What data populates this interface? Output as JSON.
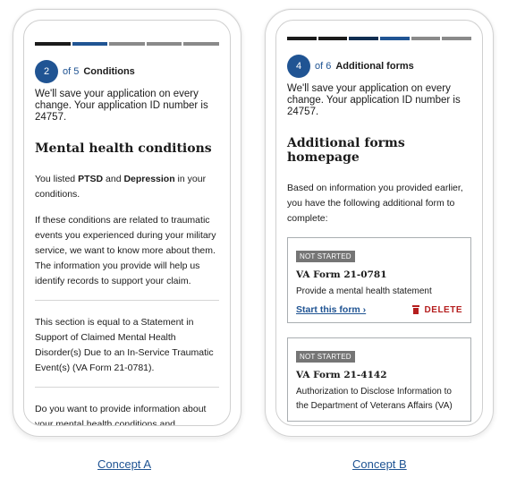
{
  "concept_a": {
    "progress": [
      "done",
      "current",
      "todo",
      "todo",
      "todo"
    ],
    "step_number": "2",
    "step_of": "of 5",
    "step_title": "Conditions",
    "save_text": "We'll save your application on every change. Your application ID number is 24757.",
    "heading": "Mental health conditions",
    "listed_pre": "You listed ",
    "listed_c1": "PTSD",
    "listed_and": " and ",
    "listed_c2": "Depression",
    "listed_post": " in your conditions.",
    "para_related": "If these conditions are related to traumatic events you experienced during your military service, we want to know more about them. The information you provide will help us identify records to support your claim.",
    "para_section": "This section is equal to a Statement in Support of Claimed Mental Health Disorder(s) Due to an In-Service Traumatic Event(s) (VA Form 21-0781).",
    "para_question": "Do you want to provide information about your mental health conditions and"
  },
  "concept_b": {
    "progress": [
      "done",
      "done",
      "done",
      "current",
      "todo",
      "todo"
    ],
    "step_number": "4",
    "step_of": "of 6",
    "step_title": "Additional forms",
    "save_text": "We'll save your application on every change. Your application ID number is 24757.",
    "heading": "Additional forms homepage",
    "intro": "Based on information you provided earlier, you have the following additional form to complete:",
    "cards": [
      {
        "badge": "NOT STARTED",
        "title": "VA Form 21-0781",
        "desc": "Provide a mental health statement",
        "start_label": "Start this form ›",
        "delete_label": "DELETE"
      },
      {
        "badge": "NOT STARTED",
        "title": "VA Form 21-4142",
        "desc": "Authorization to Disclose Information to the Department of Veterans Affairs (VA)"
      }
    ]
  },
  "captions": {
    "a": "Concept A",
    "b": "Concept B"
  },
  "colors": {
    "primary_blue": "#205493",
    "progress_done": "#1b1b1b",
    "progress_todo": "#8a8a8a",
    "delete_red": "#b51e1e",
    "badge_gray": "#757575"
  }
}
